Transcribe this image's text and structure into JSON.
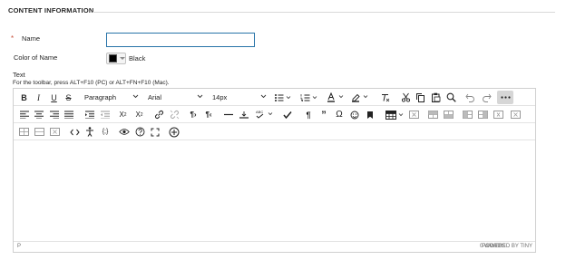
{
  "section": {
    "title": "CONTENT INFORMATION"
  },
  "form": {
    "name_label": "Name",
    "required_mark": "*",
    "name_value": "",
    "color_label": "Color of Name",
    "color_value": "Black",
    "color_swatch": "#000000",
    "text_label": "Text",
    "toolbar_hint": "For the toolbar, press ALT+F10 (PC) or ALT+FN+F10 (Mac)."
  },
  "editor": {
    "block_format": "Paragraph",
    "font_family": "Arial",
    "font_size": "14px",
    "status_path": "P",
    "word_count": "0 WORDS",
    "powered_by": "POWERED BY TINY",
    "accent_color": "#2773a8"
  },
  "toolbar": {
    "row1": [
      "bold-icon",
      "italic-icon",
      "underline-icon",
      "strikethrough-icon",
      "block-format-dropdown",
      "font-family-dropdown",
      "font-size-dropdown",
      "bullet-list-icon",
      "numbered-list-icon",
      "text-color-icon",
      "highlight-icon",
      "clear-format-icon",
      "cut-icon",
      "copy-icon",
      "paste-icon",
      "search-icon",
      "undo-icon",
      "redo-icon",
      "more-icon"
    ],
    "row2": [
      "align-left-icon",
      "align-center-icon",
      "align-right-icon",
      "justify-icon",
      "indent-icon",
      "outdent-icon",
      "superscript-icon",
      "subscript-icon",
      "link-icon",
      "unlink-icon",
      "ltr-icon",
      "rtl-icon",
      "horizontal-rule-icon",
      "page-break-icon",
      "spellcheck-icon",
      "accessibility-check-icon",
      "paragraph-mark-icon",
      "quote-icon",
      "special-char-icon",
      "emoji-icon",
      "bookmark-icon",
      "table-icon",
      "table-delete-icon",
      "row-insert-before-icon",
      "row-insert-after-icon",
      "col-insert-before-icon",
      "col-insert-after-icon",
      "cell-props-icon"
    ],
    "row3": [
      "table-split-icon",
      "table-merge-icon",
      "table-row-props-icon",
      "code-icon",
      "accessibility-icon",
      "template-icon",
      "preview-icon",
      "help-icon",
      "fullscreen-icon",
      "add-content-icon"
    ]
  }
}
